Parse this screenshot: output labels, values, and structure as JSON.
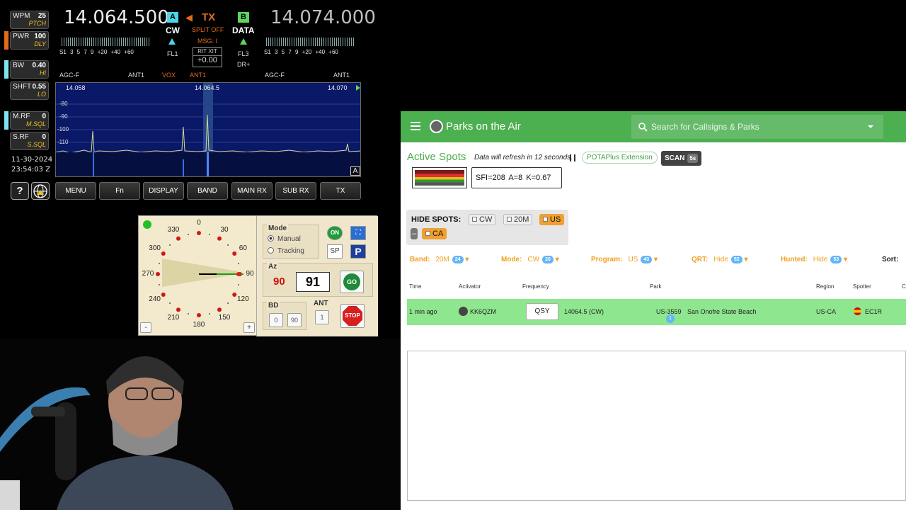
{
  "radio": {
    "left_buttons": [
      {
        "key": "WPM",
        "val": "25",
        "sub": "PTCH"
      },
      {
        "key": "PWR",
        "val": "100",
        "sub": "DLY"
      },
      {
        "key": "BW",
        "val": "0.40",
        "sub": "HI"
      },
      {
        "key": "SHFT",
        "val": "0.55",
        "sub": "LO"
      },
      {
        "key": "M.RF",
        "val": "0",
        "sub": "M.SQL"
      },
      {
        "key": "S.RF",
        "val": "0",
        "sub": "S.SQL"
      }
    ],
    "date": "11-30-2024",
    "time": "23:54:03 Z",
    "vfo_a": "14.064.500",
    "vfo_b": "14.074.000",
    "mode_a_box": "A",
    "mode_b_box": "B",
    "mode_a": "CW",
    "mode_b": "DATA",
    "tx": "TX",
    "split": "SPLIT OFF",
    "msg": "MSG: I",
    "rit": "RIT",
    "xit": "XIT",
    "rit_value": "+0.00",
    "fl_a": "FL1",
    "fl_b": "FL3",
    "dr": "DR+",
    "meter_scale": "S1 3 5 7 9 +20 +40 +60",
    "agc_a": "AGC-F",
    "ant_a": "ANT1",
    "vox": "VOX",
    "ant_mid": "ANT1",
    "agc_b": "AGC-F",
    "ant_b": "ANT1",
    "wf_left": "14.058",
    "wf_center": "14.064.5",
    "wf_right": "14.070",
    "wf_db": [
      "-80",
      "-90",
      "-100",
      "-110"
    ],
    "wf_badge": "A",
    "help": "?",
    "bottom_buttons": [
      "MENU",
      "Fn",
      "DISPLAY",
      "BAND",
      "MAIN RX",
      "SUB RX",
      "TX"
    ],
    "colors": {
      "pwr_marker": "#e46a1c",
      "cyan_marker": "#7fe3f0",
      "mode_a": "#4dd4e8",
      "mode_b": "#5cd65c",
      "tx": "#e46a1c"
    }
  },
  "rotator": {
    "dial_labels": [
      "0",
      "30",
      "60",
      "90",
      "120",
      "150",
      "180",
      "210",
      "240",
      "270",
      "300",
      "330"
    ],
    "minus": "-",
    "plus": "+",
    "mode_label": "Mode",
    "manual": "Manual",
    "tracking": "Tracking",
    "on": "ON",
    "sp": "SP",
    "p": "P",
    "az_label": "Az",
    "az_target": "90",
    "az_current": "91",
    "go": "GO",
    "bd_label": "BD",
    "bd_0": "0",
    "bd_90": "90",
    "ant_label": "ANT",
    "ant_val": "1",
    "stop": "STOP",
    "heading": 91
  },
  "pota": {
    "title": "Parks on the Air",
    "search_placeholder": "Search for Callsigns & Parks",
    "heading": "Active Spots",
    "refresh": "Data will refresh in 12 seconds.",
    "extension": "POTAPlus Extension",
    "scan": "SCAN",
    "scan_time": "5s",
    "solar": "SFI=208  A=8  K=0.67",
    "hide_label": "HIDE SPOTS:",
    "hide_chips": [
      "CW",
      "20M",
      "US",
      "CA"
    ],
    "hide_minus": "–",
    "filters": [
      {
        "label": "Band:",
        "value": "20M",
        "count": "24"
      },
      {
        "label": "Mode:",
        "value": "CW",
        "count": "20"
      },
      {
        "label": "Program:",
        "value": "US",
        "count": "43"
      },
      {
        "label": "QRT:",
        "value": "Hide",
        "count": "52"
      },
      {
        "label": "Hunted:",
        "value": "Hide",
        "count": "53"
      }
    ],
    "sort_label": "Sort:",
    "columns": [
      "Time",
      "Activator",
      "Frequency",
      "Park",
      "Region",
      "Spotter",
      "C"
    ],
    "spot": {
      "time": "1 min ago",
      "activator": "KK6QZM",
      "qsy": "QSY",
      "frequency": "14064.5 (CW)",
      "park_ref": "US-3559",
      "park_name": "San Onofre State Beach",
      "park_count": "1",
      "region": "US-CA",
      "spotter": "EC1R"
    },
    "colors": {
      "appbar": "#4caf50",
      "spot_row": "#8ee68e",
      "accent": "#f0a020"
    }
  }
}
